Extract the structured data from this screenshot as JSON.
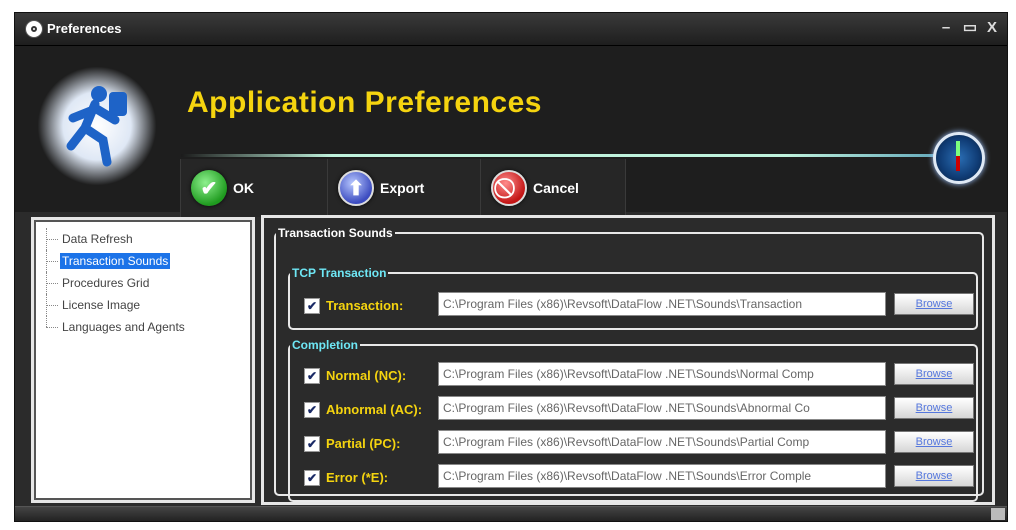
{
  "window": {
    "title": "Preferences",
    "minimize": "–",
    "maximize": "▭",
    "close": "X"
  },
  "header": {
    "title": "Application Preferences"
  },
  "toolbar": {
    "ok_label": "OK",
    "export_label": "Export",
    "cancel_label": "Cancel"
  },
  "tree": {
    "items": [
      {
        "label": "Data Refresh"
      },
      {
        "label": "Transaction Sounds"
      },
      {
        "label": "Procedures Grid"
      },
      {
        "label": "License Image"
      },
      {
        "label": "Languages and Agents"
      }
    ],
    "selected": "Transaction Sounds"
  },
  "content": {
    "section_title": "Transaction Sounds",
    "tcp": {
      "legend": "TCP Transaction",
      "rows": [
        {
          "label": "Transaction:",
          "checked": "✔",
          "path": "C:\\Program Files (x86)\\Revsoft\\DataFlow .NET\\Sounds\\Transaction",
          "browse": "Browse"
        }
      ]
    },
    "completion": {
      "legend": "Completion",
      "rows": [
        {
          "label": "Normal (NC):",
          "checked": "✔",
          "path": "C:\\Program Files (x86)\\Revsoft\\DataFlow .NET\\Sounds\\Normal Comp",
          "browse": "Browse"
        },
        {
          "label": "Abnormal (AC):",
          "checked": "✔",
          "path": "C:\\Program Files (x86)\\Revsoft\\DataFlow .NET\\Sounds\\Abnormal Co",
          "browse": "Browse"
        },
        {
          "label": "Partial (PC):",
          "checked": "✔",
          "path": "C:\\Program Files (x86)\\Revsoft\\DataFlow .NET\\Sounds\\Partial Comp",
          "browse": "Browse"
        },
        {
          "label": "Error (*E):",
          "checked": "✔",
          "path": "C:\\Program Files (x86)\\Revsoft\\DataFlow .NET\\Sounds\\Error Comple",
          "browse": "Browse"
        }
      ]
    }
  },
  "colors": {
    "title_accent": "#f5d40f",
    "legend_accent": "#6ee7f5",
    "selection": "#1c73e8"
  },
  "icons": {
    "app": "runner-icon",
    "ok": "check-icon",
    "export": "export-icon",
    "cancel": "cancel-icon",
    "compass": "compass-icon"
  }
}
